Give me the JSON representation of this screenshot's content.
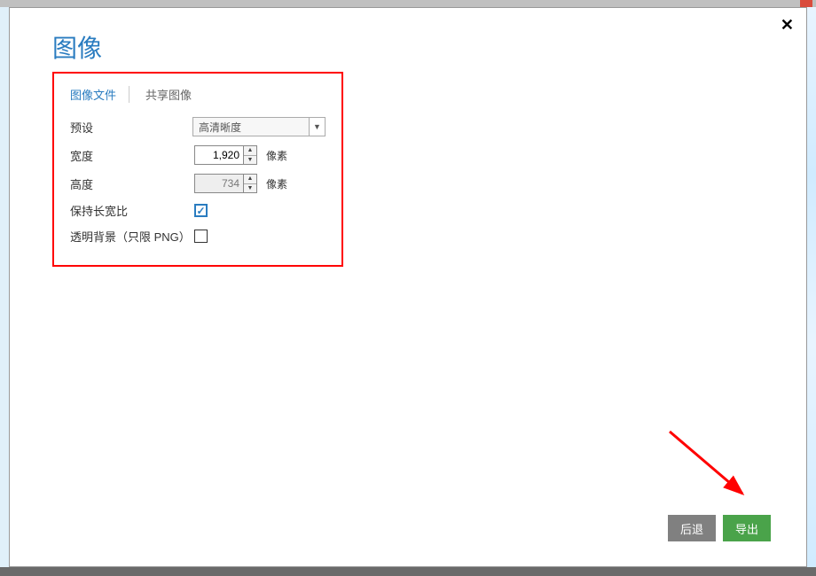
{
  "dialog": {
    "title": "图像",
    "close_symbol": "✕"
  },
  "tabs": {
    "file": "图像文件",
    "share": "共享图像"
  },
  "form": {
    "preset_label": "预设",
    "preset_value": "高清晰度",
    "width_label": "宽度",
    "width_value": "1,920",
    "height_label": "高度",
    "height_value": "734",
    "pixel_unit": "像素",
    "keep_aspect_label": "保持长宽比",
    "keep_aspect_checked": true,
    "transparent_label": "透明背景（只限 PNG）",
    "transparent_checked": false
  },
  "buttons": {
    "back": "后退",
    "export": "导出"
  }
}
